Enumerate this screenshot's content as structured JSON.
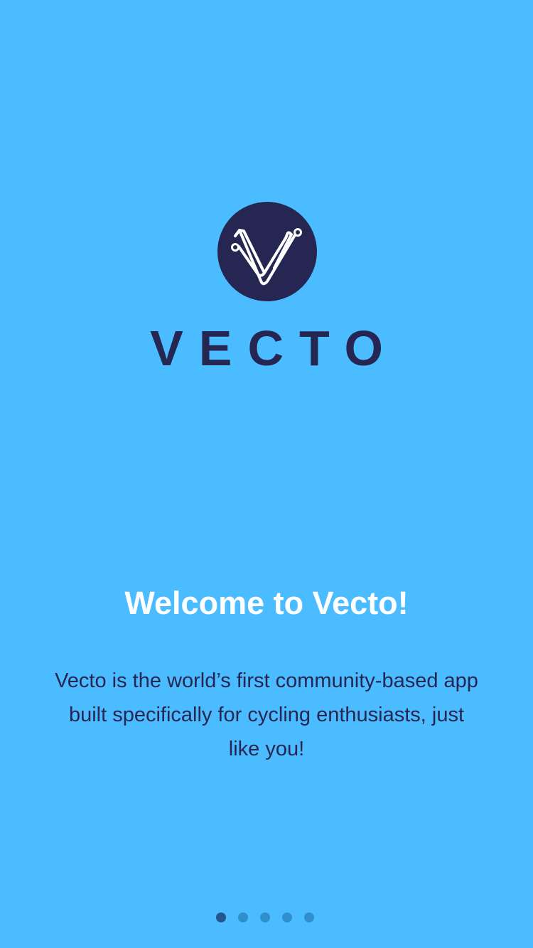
{
  "logo": {
    "mark_icon": "vecto-v-logo-icon",
    "wordmark": "VECTO"
  },
  "onboarding": {
    "title": "Welcome to Vecto!",
    "description": "Vecto is the world’s first community-based app built specifically for cycling enthusiasts, just like you!"
  },
  "pager": {
    "page_count": 5,
    "current_page": 1
  },
  "colors": {
    "background": "#4bbcff",
    "brand_navy": "#262652",
    "title_text": "#ffffff",
    "dot_active": "#23558f",
    "dot_inactive": "#2f8fcb"
  }
}
